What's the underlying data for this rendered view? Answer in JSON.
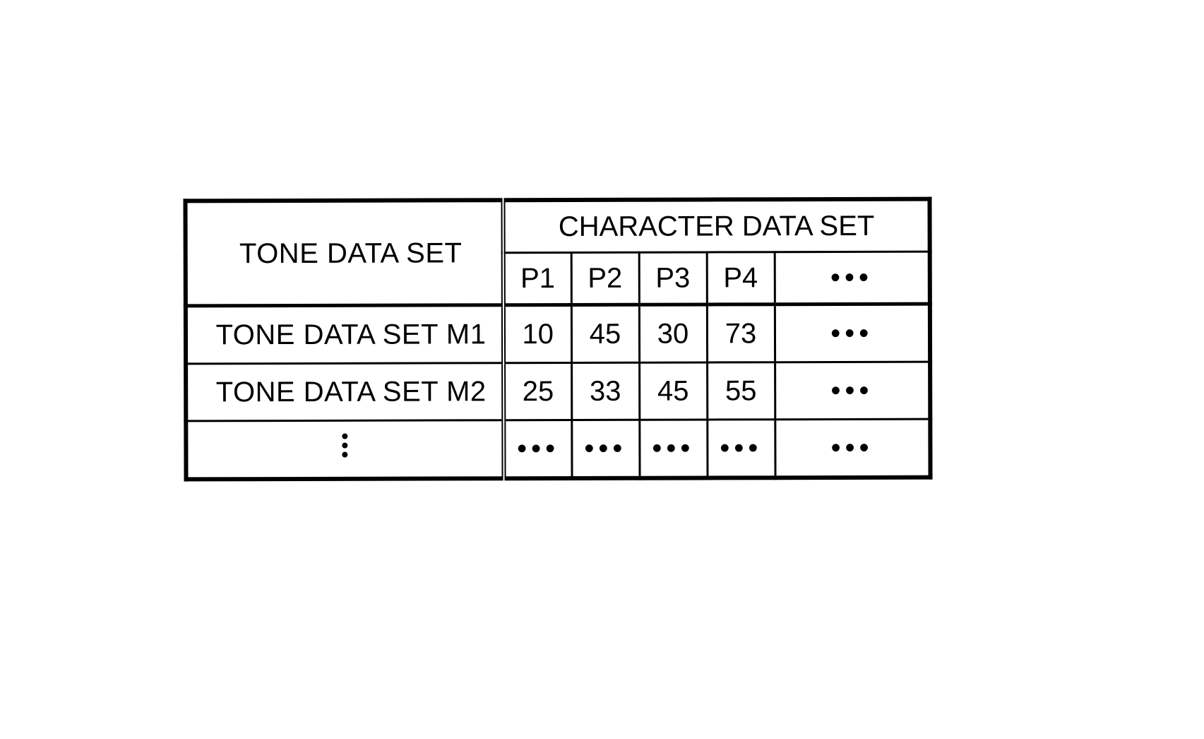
{
  "table": {
    "row_header_title": "TONE DATA SET",
    "col_group_title": "CHARACTER DATA SET",
    "columns": [
      "P1",
      "P2",
      "P3",
      "P4"
    ],
    "more_cols_glyph": "•••",
    "rows": [
      {
        "label": "TONE DATA SET M1",
        "values": [
          "10",
          "45",
          "30",
          "73"
        ],
        "more": "•••"
      },
      {
        "label": "TONE DATA SET M2",
        "values": [
          "25",
          "33",
          "45",
          "55"
        ],
        "more": "•••"
      }
    ],
    "more_rows": {
      "label_glyph_vertical": [
        "•",
        "•",
        "•"
      ],
      "cell_glyph": "•••"
    }
  }
}
